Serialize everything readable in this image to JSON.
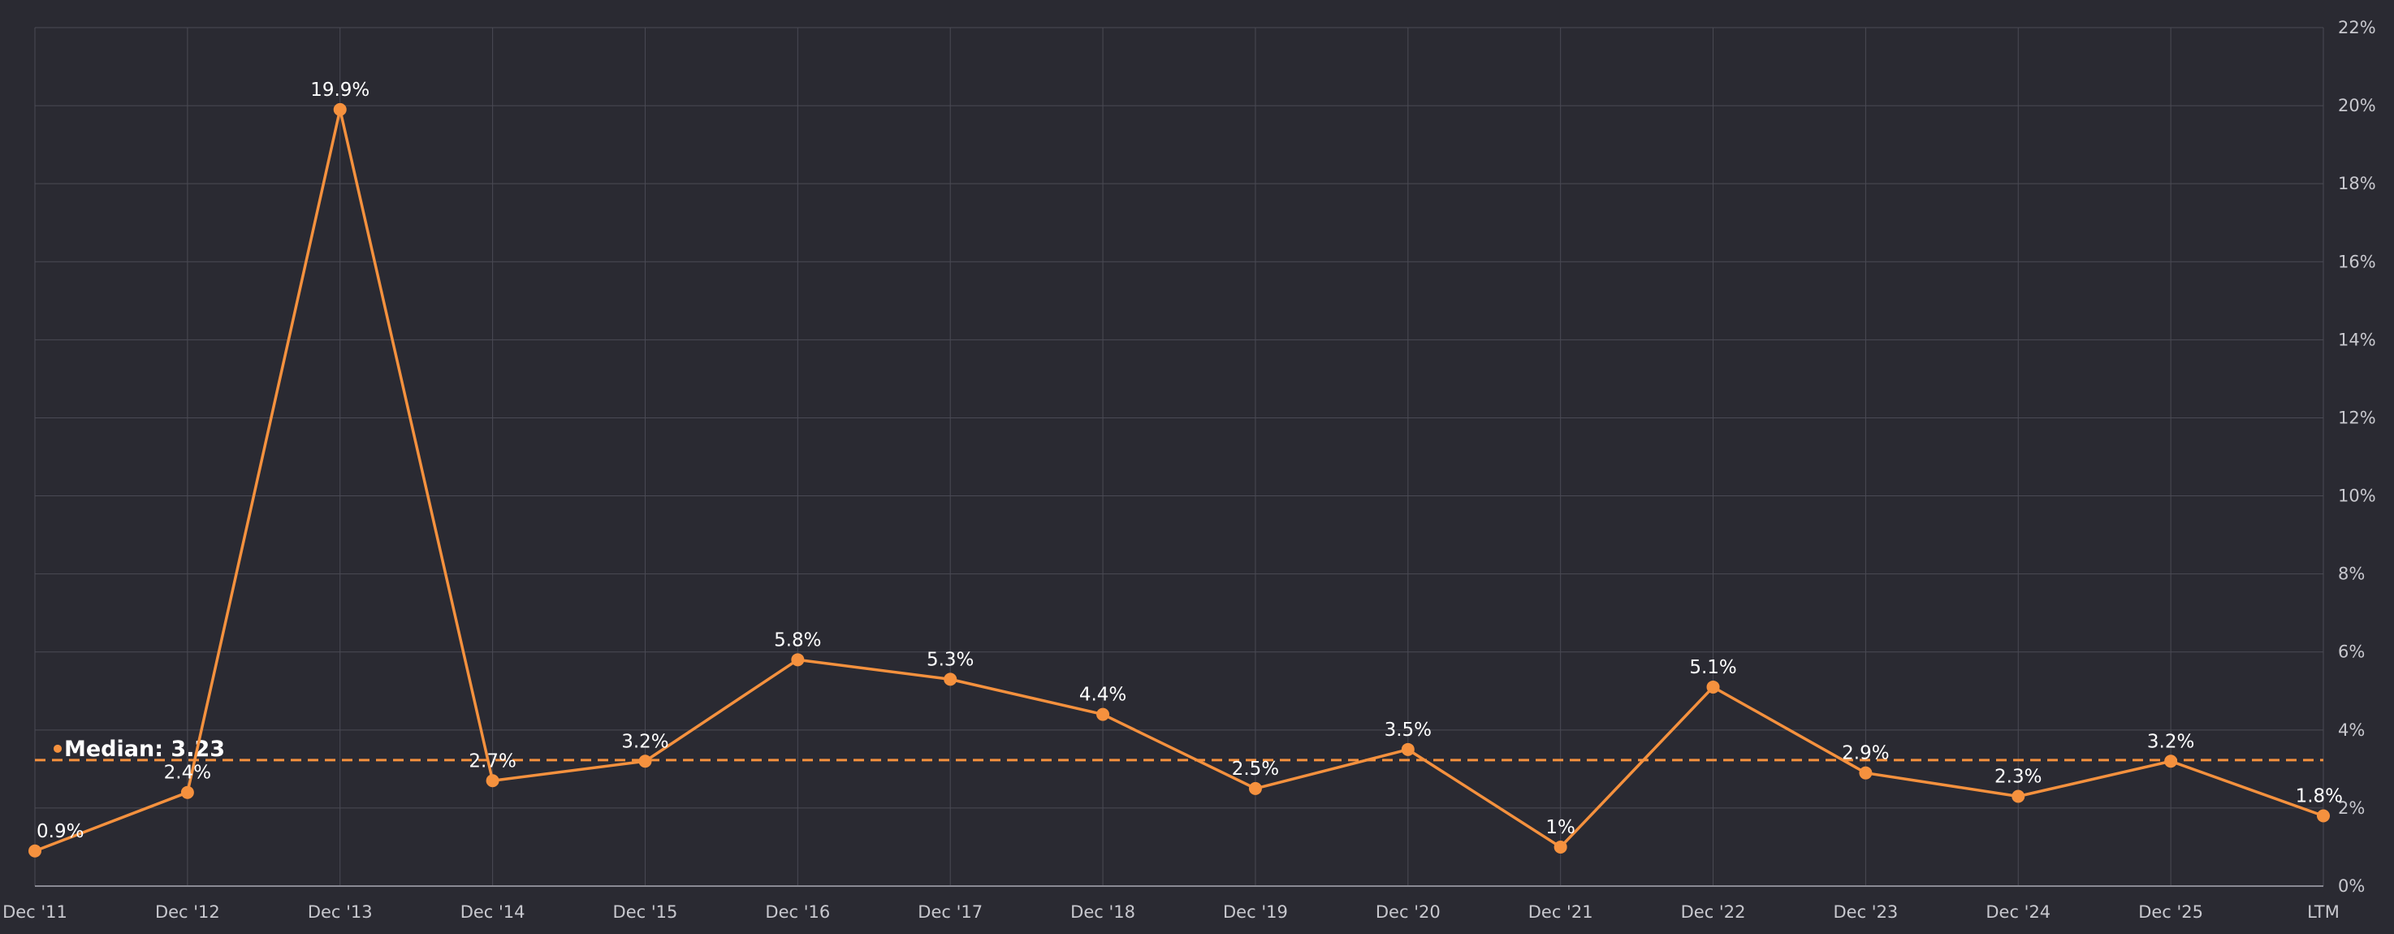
{
  "chart_data": {
    "type": "line",
    "categories": [
      "Dec '11",
      "Dec '12",
      "Dec '13",
      "Dec '14",
      "Dec '15",
      "Dec '16",
      "Dec '17",
      "Dec '18",
      "Dec '19",
      "Dec '20",
      "Dec '21",
      "Dec '22",
      "Dec '23",
      "Dec '24",
      "Dec '25",
      "LTM"
    ],
    "series": [
      {
        "values": [
          0.9,
          2.4,
          19.9,
          2.7,
          3.2,
          5.8,
          5.3,
          4.4,
          2.5,
          3.5,
          1.0,
          5.1,
          2.9,
          2.3,
          3.2,
          1.8
        ],
        "labels": [
          "0.9%",
          "2.4%",
          "19.9%",
          "2.7%",
          "3.2%",
          "5.8%",
          "5.3%",
          "4.4%",
          "2.5%",
          "3.5%",
          "1%",
          "5.1%",
          "2.9%",
          "2.3%",
          "3.2%",
          "1.8%"
        ],
        "color": "#f5913e"
      }
    ],
    "ylim": [
      0,
      22
    ],
    "yticks": [
      0,
      2,
      4,
      6,
      8,
      10,
      12,
      14,
      16,
      18,
      20,
      22
    ],
    "ytick_labels": [
      "0%",
      "2%",
      "4%",
      "6%",
      "8%",
      "10%",
      "12%",
      "14%",
      "16%",
      "18%",
      "20%",
      "22%"
    ],
    "y_axis_position": "right",
    "grid": true,
    "median": {
      "value": 3.23,
      "label": "Median: 3.23",
      "color": "#f5913e"
    },
    "colors": {
      "background": "#2a2a32",
      "grid": "#4a4a54",
      "line": "#f5913e"
    }
  }
}
